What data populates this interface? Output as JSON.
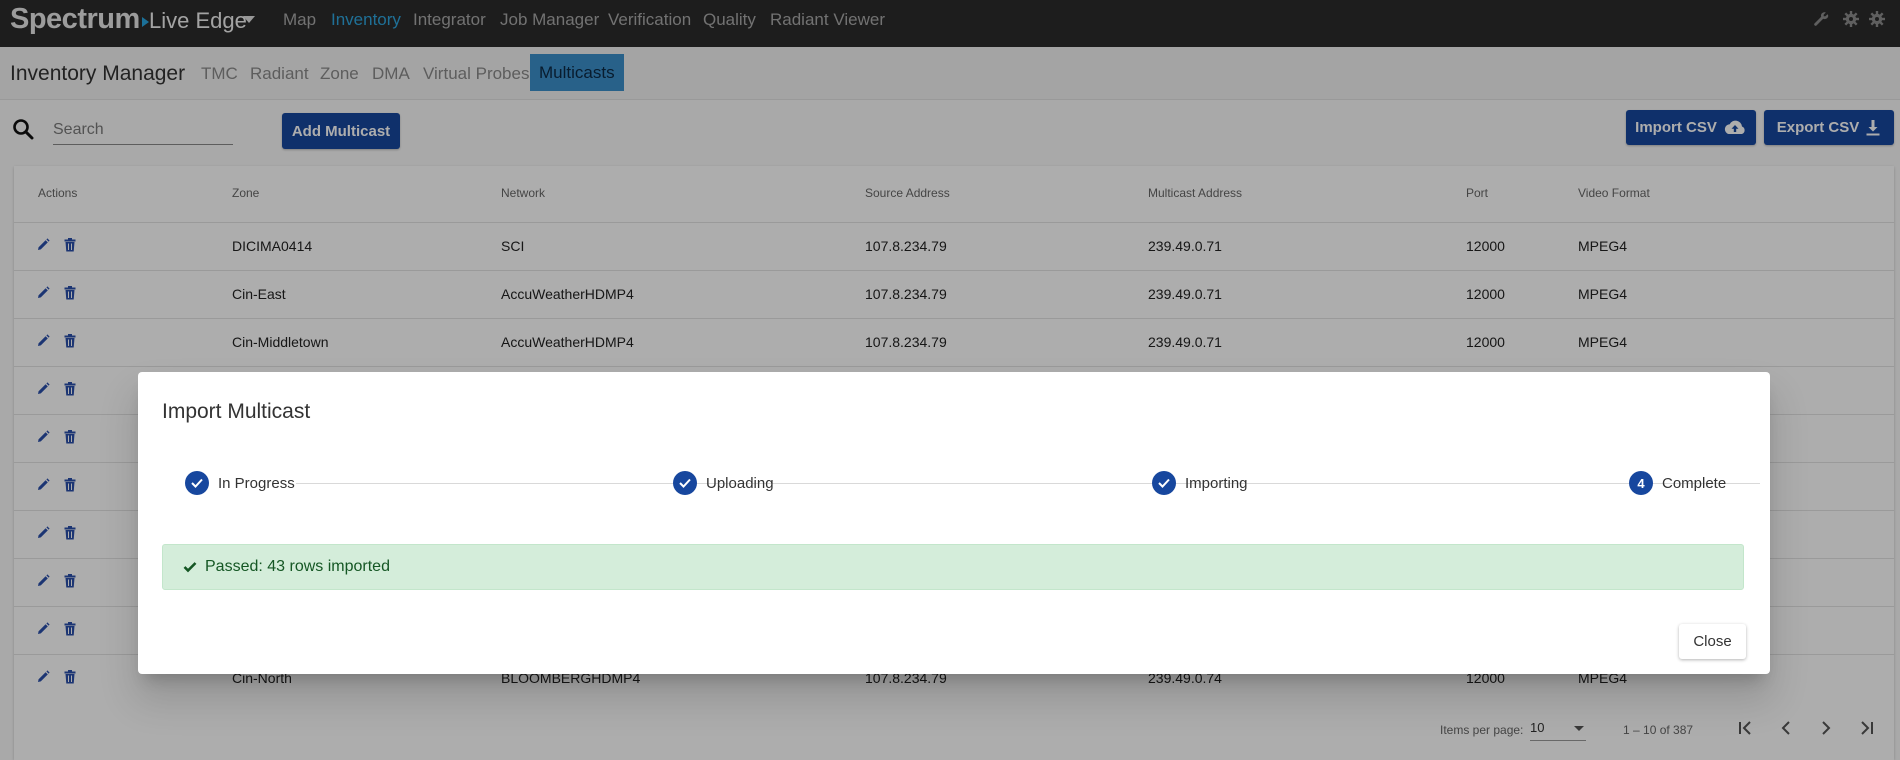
{
  "app": {
    "logo": "Spectrum",
    "name": "Live Edge",
    "nav": [
      "Map",
      "Inventory",
      "Integrator",
      "Job Manager",
      "Verification",
      "Quality",
      "Radiant Viewer"
    ],
    "active_nav": "Inventory",
    "accent_color": "#2ea6df",
    "toolbar_icons": [
      "wrench-icon",
      "gear-icon",
      "gear-icon"
    ]
  },
  "subnav": {
    "title": "Inventory Manager",
    "tabs": [
      "TMC",
      "Radiant",
      "Zone",
      "DMA",
      "Virtual Probes",
      "Multicasts"
    ],
    "active_tab": "Multicasts"
  },
  "toolbar": {
    "search_placeholder": "Search",
    "add_label": "Add Multicast",
    "import_label": "Import CSV",
    "export_label": "Export CSV",
    "button_color": "#17479e"
  },
  "table": {
    "columns": [
      "Actions",
      "Zone",
      "Network",
      "Source Address",
      "Multicast Address",
      "Port",
      "Video Format"
    ],
    "rows": [
      [
        "DICIMA0414",
        "SCI",
        "107.8.234.79",
        "239.49.0.71",
        "12000",
        "MPEG4"
      ],
      [
        "Cin-East",
        "AccuWeatherHDMP4",
        "107.8.234.79",
        "239.49.0.71",
        "12000",
        "MPEG4"
      ],
      [
        "Cin-Middletown",
        "AccuWeatherHDMP4",
        "107.8.234.79",
        "239.49.0.71",
        "12000",
        "MPEG4"
      ],
      [
        "",
        "",
        "",
        "",
        "",
        ""
      ],
      [
        "",
        "",
        "",
        "",
        "",
        ""
      ],
      [
        "",
        "",
        "",
        "",
        "",
        ""
      ],
      [
        "",
        "",
        "",
        "",
        "",
        ""
      ],
      [
        "",
        "",
        "",
        "",
        "",
        ""
      ],
      [
        "",
        "",
        "",
        "",
        "",
        ""
      ],
      [
        "Cin-North",
        "BLOOMBERGHDMP4",
        "107.8.234.79",
        "239.49.0.74",
        "12000",
        "MPEG4"
      ]
    ],
    "row_action_icons": [
      "pencil-icon",
      "trash-icon"
    ],
    "items_per_page_label": "Items per page:",
    "items_per_page": "10",
    "range": "1 – 10 of 387"
  },
  "modal": {
    "title": "Import Multicast",
    "steps": [
      {
        "label": "In Progress",
        "state": "done"
      },
      {
        "label": "Uploading",
        "state": "done"
      },
      {
        "label": "Importing",
        "state": "done"
      },
      {
        "label": "Complete",
        "state": "current",
        "number": "4"
      }
    ],
    "alert": "Passed: 43 rows imported",
    "alert_color": "#155724",
    "close_label": "Close"
  }
}
